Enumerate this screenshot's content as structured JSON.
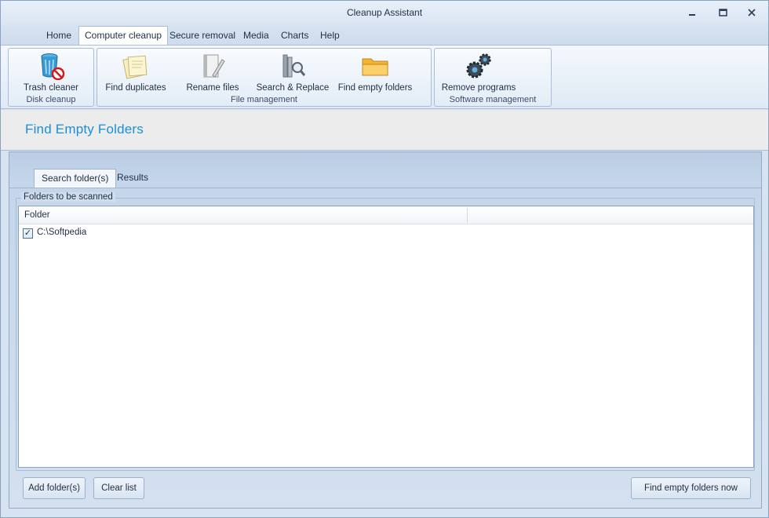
{
  "window": {
    "title": "Cleanup Assistant",
    "controls": {
      "minimize": "▁",
      "restore": "▣",
      "close": "✕"
    }
  },
  "menu": {
    "items": [
      {
        "label": "Home",
        "active": false
      },
      {
        "label": "Computer cleanup",
        "active": true
      },
      {
        "label": "Secure removal",
        "active": false
      },
      {
        "label": "Media",
        "active": false
      },
      {
        "label": "Charts",
        "active": false
      },
      {
        "label": "Help",
        "active": false
      }
    ]
  },
  "ribbon": {
    "groups": [
      {
        "label": "Disk cleanup",
        "buttons": [
          {
            "label": "Trash cleaner",
            "icon": "trash-cleaner-icon"
          }
        ]
      },
      {
        "label": "File management",
        "buttons": [
          {
            "label": "Find duplicates",
            "icon": "documents-icon"
          },
          {
            "label": "Rename files",
            "icon": "rename-icon"
          },
          {
            "label": "Search & Replace",
            "icon": "search-replace-icon"
          },
          {
            "label": "Find empty folders",
            "icon": "folder-icon"
          }
        ]
      },
      {
        "label": "Software management",
        "buttons": [
          {
            "label": "Remove programs",
            "icon": "gears-icon"
          }
        ]
      }
    ]
  },
  "page": {
    "title": "Find Empty Folders"
  },
  "tabs": [
    {
      "label": "Search folder(s)",
      "active": true
    },
    {
      "label": "Results",
      "active": false
    }
  ],
  "scan": {
    "legend": "Folders to be scanned",
    "columns": [
      "Folder",
      ""
    ],
    "rows": [
      {
        "checked": true,
        "folder": "C:\\Softpedia"
      }
    ]
  },
  "buttons": {
    "add": "Add folder(s)",
    "clear": "Clear list",
    "find": "Find empty folders now"
  },
  "colors": {
    "accent": "#1a8fd8",
    "background": "#d7e3f1"
  }
}
